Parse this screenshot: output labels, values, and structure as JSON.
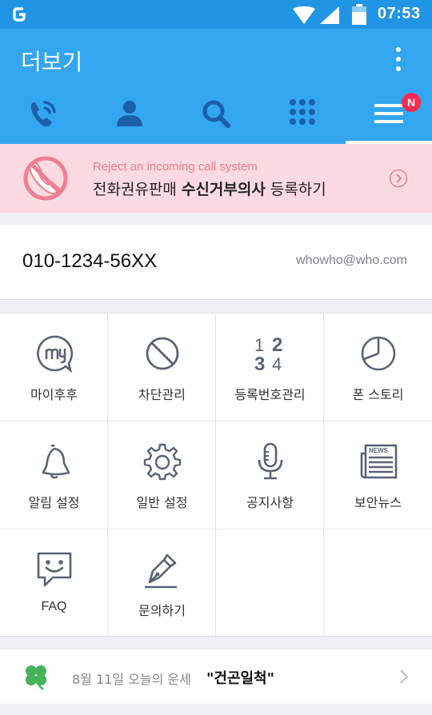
{
  "status_bar": {
    "time": "07:53",
    "icons": [
      "app-notification-icon",
      "wifi-icon",
      "signal-icon",
      "battery-icon"
    ]
  },
  "header": {
    "title": "더보기",
    "menu_icon": "overflow-menu-icon",
    "background_color": "#33a6f2",
    "tabs": [
      {
        "icon": "phone-call-icon",
        "active": false
      },
      {
        "icon": "contact-person-icon",
        "active": false
      },
      {
        "icon": "search-icon",
        "active": false
      },
      {
        "icon": "dialpad-icon",
        "active": false
      },
      {
        "icon": "hamburger-menu-icon",
        "active": true,
        "badge": "N"
      }
    ]
  },
  "banner": {
    "subtitle": "Reject an incoming call system",
    "text_pre": "전화권유판매 ",
    "text_bold": "수신거부의사",
    "text_post": " 등록하기",
    "background_color": "#fbdbe1",
    "accent_color": "#f07d91"
  },
  "account": {
    "phone": "010-1234-56XX",
    "email": "whowho@who.com"
  },
  "menu": {
    "items": [
      {
        "label": "마이후후",
        "icon": "my-chat-bubble-icon"
      },
      {
        "label": "차단관리",
        "icon": "block-icon"
      },
      {
        "label": "등록번호관리",
        "icon": "numbers-icon"
      },
      {
        "label": "폰 스토리",
        "icon": "pie-chart-icon"
      },
      {
        "label": "알림 설정",
        "icon": "bell-icon"
      },
      {
        "label": "일반 설정",
        "icon": "gear-icon"
      },
      {
        "label": "공지사항",
        "icon": "microphone-icon"
      },
      {
        "label": "보안뉴스",
        "icon": "newspaper-icon"
      },
      {
        "label": "FAQ",
        "icon": "smiley-chat-icon"
      },
      {
        "label": "문의하기",
        "icon": "pen-nib-icon"
      }
    ],
    "numbers_glyph": [
      "1",
      "2",
      "3",
      "4"
    ],
    "newspaper_glyph": "NEWS"
  },
  "fortune": {
    "date_text": "8월 11일 오늘의 운세",
    "word": "\"건곤일척\""
  }
}
